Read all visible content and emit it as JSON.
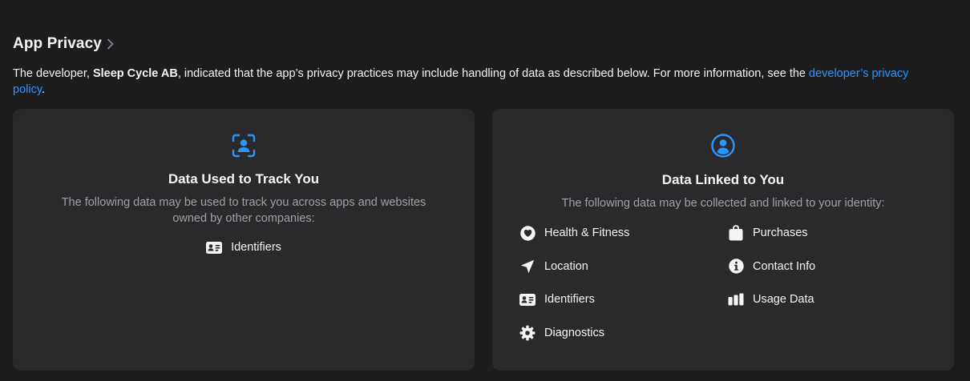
{
  "header": {
    "title": "App Privacy"
  },
  "description": {
    "prefix": "The developer, ",
    "developer": "Sleep Cycle AB",
    "middle": ", indicated that the app’s privacy practices may include handling of data as described below. For more information, see the ",
    "link": "developer’s privacy policy",
    "suffix": "."
  },
  "track_card": {
    "icon": "tracking-icon",
    "title": "Data Used to Track You",
    "subtitle": "The following data may be used to track you across apps and websites owned by other companies:",
    "items": [
      {
        "label": "Identifiers",
        "icon": "id-card-icon"
      }
    ]
  },
  "linked_card": {
    "icon": "person-circle-icon",
    "title": "Data Linked to You",
    "subtitle": "The following data may be collected and linked to your identity:",
    "items": [
      {
        "label": "Health & Fitness",
        "icon": "heart-icon"
      },
      {
        "label": "Purchases",
        "icon": "bag-icon"
      },
      {
        "label": "Location",
        "icon": "location-arrow-icon"
      },
      {
        "label": "Contact Info",
        "icon": "info-icon"
      },
      {
        "label": "Identifiers",
        "icon": "id-card-icon"
      },
      {
        "label": "Usage Data",
        "icon": "bar-chart-icon"
      },
      {
        "label": "Diagnostics",
        "icon": "gear-icon"
      }
    ]
  },
  "colors": {
    "background": "#1d1d1f",
    "card": "#2a2a2c",
    "accent": "#2997ff",
    "text": "#f5f5f7",
    "secondary_text": "#a1a1a6"
  }
}
